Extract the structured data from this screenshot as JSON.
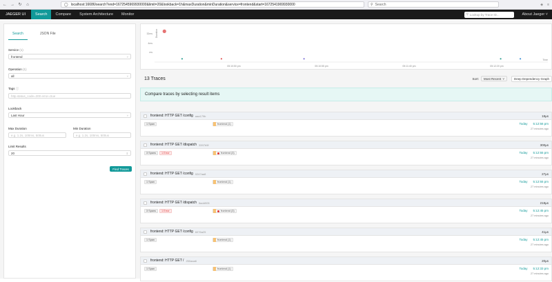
{
  "browser": {
    "url": "localhost:16686/search?end=1672545969930000&limit=20&lookback=1h&maxDuration&minDuration&service=frontend&start=1672541969930000",
    "search_placeholder": "Search"
  },
  "appbar": {
    "brand": "JAEGER UI",
    "nav": [
      "Search",
      "Compare",
      "System Architecture",
      "Monitor"
    ],
    "lookup_placeholder": "Lookup by Trace ID...",
    "about": "About Jaeger"
  },
  "form": {
    "tabs": [
      "Search",
      "JSON File"
    ],
    "service_label": "Service",
    "service_count": "(1)",
    "service_value": "frontend",
    "operation_label": "Operation",
    "operation_count": "(1)",
    "operation_value": "all",
    "tags_label": "Tags",
    "tags_placeholder": "http.status_code=200 error=true",
    "lookback_label": "Lookback",
    "lookback_value": "Last Hour",
    "max_duration_label": "Max Duration",
    "max_duration_placeholder": "e.g. 1.2s, 100ms, 500us",
    "min_duration_label": "Min Duration",
    "min_duration_placeholder": "e.g. 1.2s, 100ms, 500us",
    "limit_label": "Limit Results",
    "limit_value": "20",
    "find_button": "Find Traces"
  },
  "scatter": {
    "y_ticks": [
      "32ms",
      "4ms",
      "ms"
    ],
    "y_axis_label": "Duration",
    "x_ticks": [
      "05:10:50 pm",
      "05:10:55 pm",
      "05:11:40 pm",
      "05:12:20 pm"
    ],
    "x_axis_label": "Time",
    "points": [
      {
        "x": 0.07,
        "y": 0.9,
        "color": "#2a9d8f"
      },
      {
        "x": 0.17,
        "y": 0.9,
        "color": "#e05050"
      },
      {
        "x": 0.38,
        "y": 0.9,
        "color": "#7b6fd6"
      },
      {
        "x": 0.88,
        "y": 0.9,
        "color": "#2a9d8f"
      },
      {
        "x": 0.93,
        "y": 0.9,
        "color": "#3d8fd6"
      },
      {
        "x": 0.025,
        "y": 0.05,
        "color": "#e05050",
        "big": true
      }
    ]
  },
  "results": {
    "count_text": "13 Traces",
    "sort_label": "Sort:",
    "sort_value": "Most Recent",
    "ddg_button": "Deep Dependency Graph",
    "compare_text": "Compare traces by selecting result items"
  },
  "traces": [
    {
      "name": "frontend: HTTP GET /config",
      "id": "aaa179b",
      "duration": "18µs",
      "spans": "1 Span",
      "error": "",
      "service": "frontend (1)",
      "has_error": false,
      "today": "Today",
      "time": "5:12:56 pm",
      "ago": "27 minutes ago"
    },
    {
      "name": "frontend: HTTP GET /dispatch",
      "id": "3397b5f",
      "duration": "300µs",
      "spans": "3 Spans",
      "error": "1 Error",
      "service": "frontend (3)",
      "has_error": true,
      "today": "Today",
      "time": "5:12:55 pm",
      "ago": "27 minutes ago"
    },
    {
      "name": "frontend: HTTP GET /config",
      "id": "0247aa8",
      "duration": "27µs",
      "spans": "1 Span",
      "error": "",
      "service": "frontend (1)",
      "has_error": false,
      "today": "Today",
      "time": "5:12:55 pm",
      "ago": "27 minutes ago"
    },
    {
      "name": "frontend: HTTP GET /dispatch",
      "id": "8add905",
      "duration": "218µs",
      "spans": "3 Spans",
      "error": "1 Error",
      "service": "frontend (3)",
      "has_error": true,
      "today": "Today",
      "time": "5:12:45 pm",
      "ago": "27 minutes ago"
    },
    {
      "name": "frontend: HTTP GET /config",
      "id": "6076a25",
      "duration": "41µs",
      "spans": "1 Span",
      "error": "",
      "service": "frontend (1)",
      "has_error": false,
      "today": "Today",
      "time": "5:12:45 pm",
      "ago": "27 minutes ago"
    },
    {
      "name": "frontend: HTTP GET /",
      "id": "250aaa6",
      "duration": "20µs",
      "spans": "1 Span",
      "error": "",
      "service": "frontend (1)",
      "has_error": false,
      "today": "Today",
      "time": "5:12:33 pm",
      "ago": "27 minutes ago"
    }
  ]
}
